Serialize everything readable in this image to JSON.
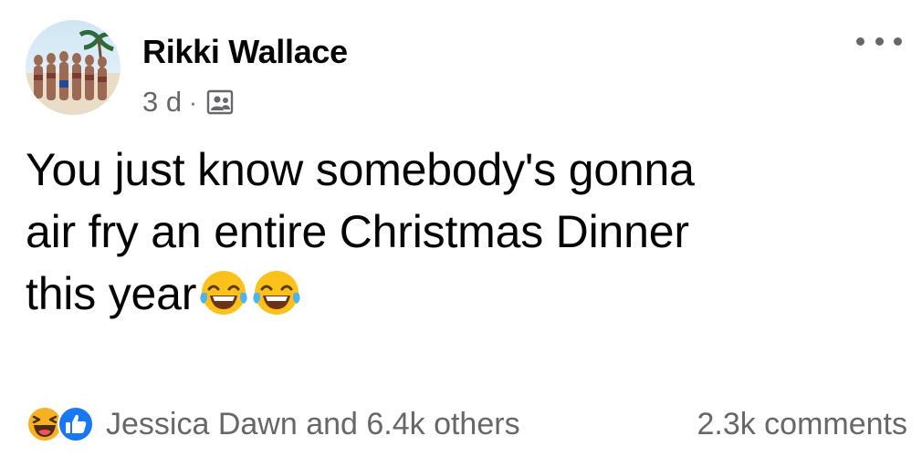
{
  "post": {
    "author": "Rikki Wallace",
    "time": "3 d",
    "separator": "·",
    "audience_icon": "friends-icon",
    "menu_icon": "more-options-icon",
    "text_lines": [
      "You just know somebody's gonna",
      "air fry an entire Christmas Dinner",
      "this year"
    ],
    "text_emojis": [
      "tears-of-joy-emoji",
      "tears-of-joy-emoji"
    ],
    "reactions": {
      "icons": [
        "haha-reaction-icon",
        "like-reaction-icon"
      ],
      "summary": "Jessica Dawn and 6.4k others"
    },
    "comments": "2.3k comments"
  },
  "colors": {
    "text_primary": "#050505",
    "text_secondary": "#65676b",
    "like_blue": "#1877f2",
    "haha_yellow": "#f7b125"
  }
}
